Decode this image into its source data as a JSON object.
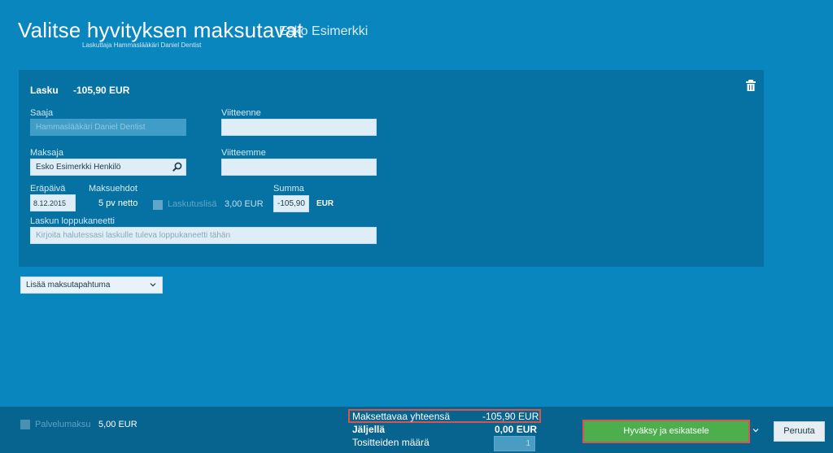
{
  "header": {
    "title": "Valitse hyvityksen maksutavat",
    "subtitle": "Esko Esimerkki",
    "biller": "Laskuttaja Hammaslääkäri Daniel Dentist"
  },
  "invoice": {
    "label": "Lasku",
    "amount": "-105,90 EUR",
    "delete_icon": "trash-icon",
    "recipient_label": "Saaja",
    "recipient_value": "Hammaslääkäri Daniel Dentist",
    "our_reference_label": "Viitteenne",
    "our_reference_value": "",
    "payer_label": "Maksaja",
    "payer_value": "Esko Esimerkki Henkilö",
    "payer_search_icon": "search-icon",
    "their_reference_label": "Viitteemme",
    "their_reference_value": "",
    "due_date_label": "Eräpäivä",
    "due_date_value": "8.12.2015",
    "terms_label": "Maksuehdot",
    "terms_value": "5 pv netto",
    "invoice_fee_label": "Laskutuslisä",
    "invoice_fee_value": "3,00 EUR",
    "sum_label": "Summa",
    "sum_value": "-105,90",
    "sum_currency": "EUR",
    "footnote_label": "Laskun loppukaneetti",
    "footnote_placeholder": "Kirjoita halutessasi laskulle tuleva loppukaneetti tähän"
  },
  "add_payment": {
    "label": "Lisää maksutapahtuma"
  },
  "footer": {
    "service_fee_label": "Palvelumaksu",
    "service_fee_value": "5,00 EUR",
    "total_label": "Maksettavaa yhteensä",
    "total_value": "-105,90 EUR",
    "remaining_label": "Jäljellä",
    "remaining_value": "0,00 EUR",
    "vouchers_label": "Tositteiden määrä",
    "vouchers_value": "1",
    "approve_label": "Hyväksy ja esikatsele",
    "cancel_label": "Peruuta"
  },
  "colors": {
    "background": "#0a86bf",
    "panel": "#0672a3",
    "footer": "#07648f",
    "approve": "#4cae4c",
    "highlight": "#d9534f"
  }
}
